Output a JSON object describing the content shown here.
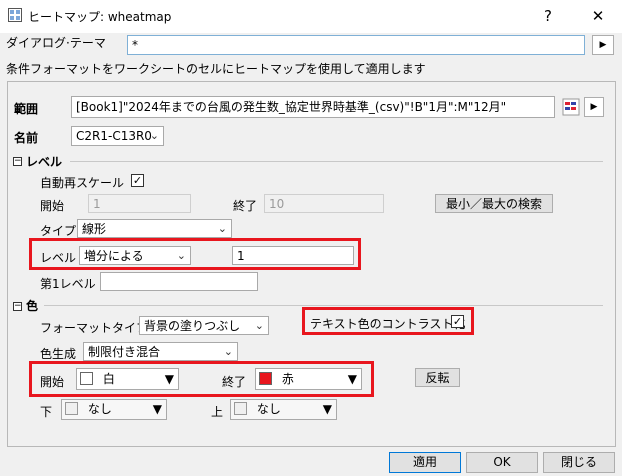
{
  "window": {
    "title": "ヒートマップ: wheatmap",
    "help": "?",
    "close": "✕"
  },
  "theme": {
    "label": "ダイアログ·テーマ",
    "value": "*",
    "arrow": "▶"
  },
  "description": "条件フォーマットをワークシートのセルにヒートマップを使用して適用します",
  "range": {
    "label": "範囲",
    "value": "[Book1]\"2024年までの台風の発生数_協定世界時基準_(csv)\"!B\"1月\":M\"12月\"",
    "arrow": "▶"
  },
  "name": {
    "label": "名前",
    "value": "C2R1-C13R0"
  },
  "levels": {
    "section_label": "レベル",
    "auto_rescale_label": "自動再スケール",
    "auto_rescale_checked": "✓",
    "start_label": "開始",
    "start_value": "1",
    "end_label": "終了",
    "end_value": "10",
    "find_minmax_button": "最小／最大の検索",
    "type_label": "タイプ",
    "type_value": "線形",
    "level_label": "レベル",
    "level_mode": "増分による",
    "level_value": "1",
    "first_level_label": "第1レベル",
    "first_level_value": ""
  },
  "color": {
    "section_label": "色",
    "format_type_label": "フォーマットタイプ",
    "format_type_value": "背景の塗りつぶし",
    "contrast_label": "テキスト色のコントラスト化",
    "contrast_checked": "✓",
    "gen_label": "色生成",
    "gen_value": "制限付き混合",
    "start_label": "開始",
    "start_color_name": "白",
    "start_color": "#ffffff",
    "end_label": "終了",
    "end_color_name": "赤",
    "end_color": "#e8161e",
    "reverse_button": "反転",
    "low_label": "下",
    "low_value": "なし",
    "high_label": "上",
    "high_value": "なし"
  },
  "footer": {
    "apply": "適用",
    "ok": "OK",
    "close": "閉じる"
  },
  "accent": "#e8161e"
}
